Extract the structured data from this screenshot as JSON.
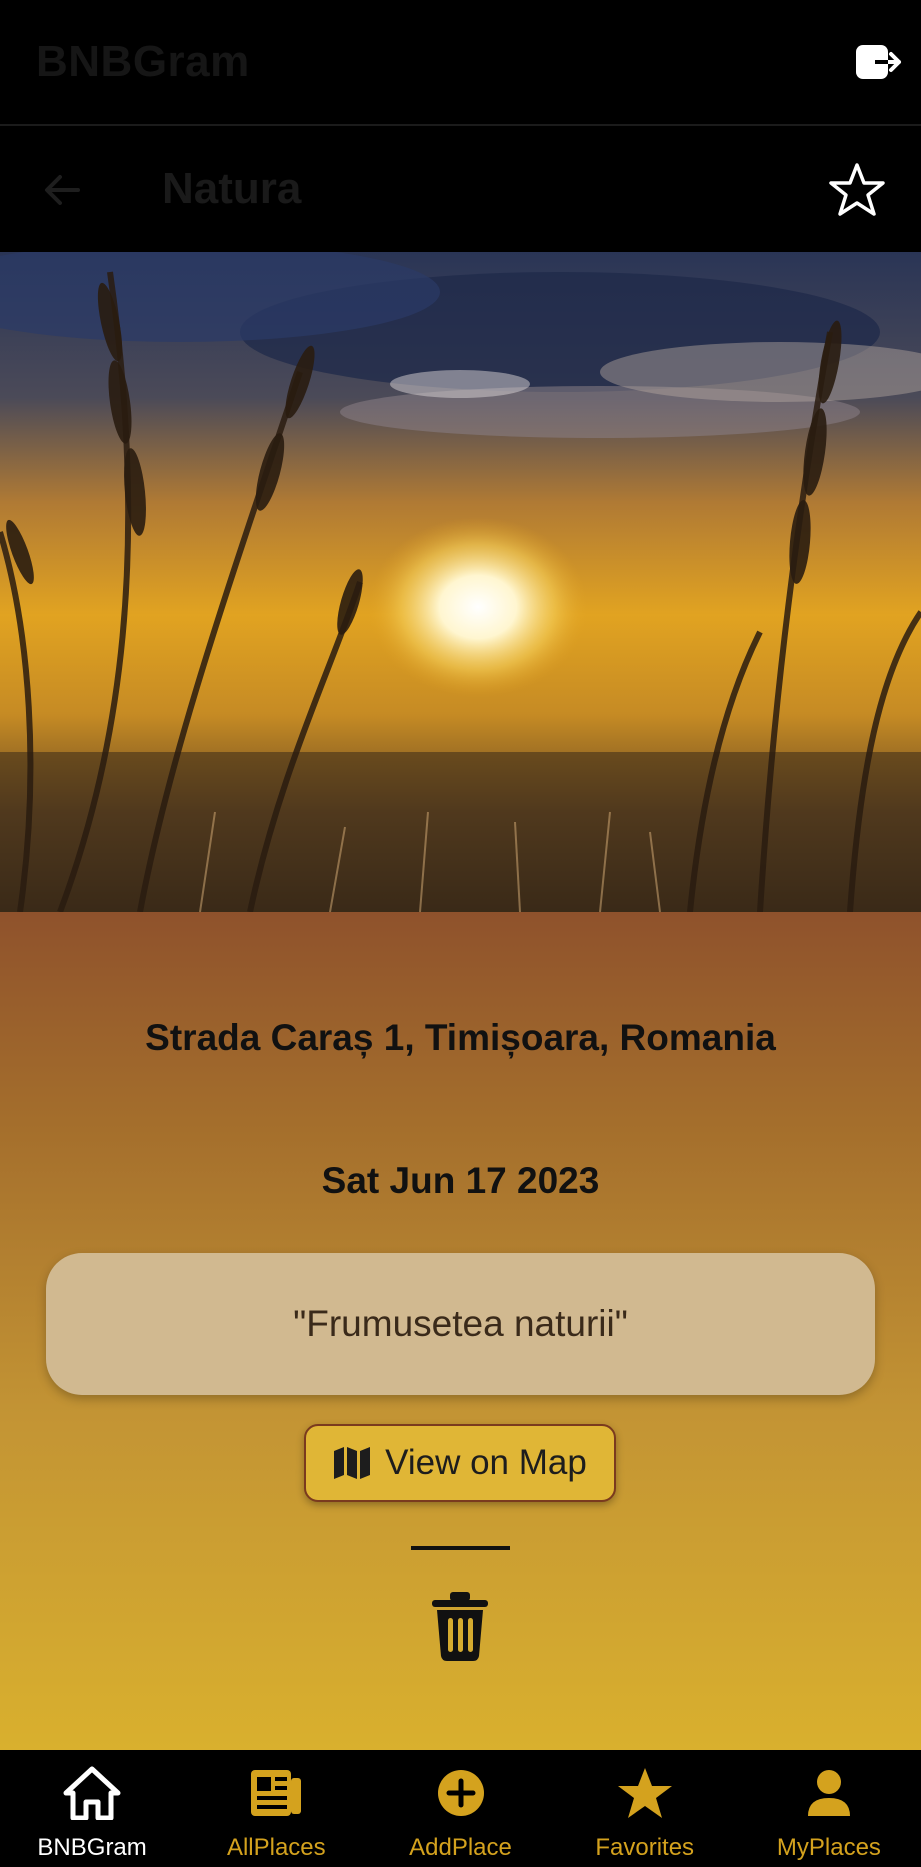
{
  "header": {
    "app_title": "BNBGram",
    "logout_icon": "logout-icon"
  },
  "subheader": {
    "title": "Natura",
    "back_icon": "arrow-left-icon",
    "favorite_icon": "star-outline-icon"
  },
  "place": {
    "photo": "sunset over wheat field",
    "address": "Strada Caraș 1, Timișoara, Romania",
    "date": "Sat Jun 17 2023",
    "description": "\"Frumusetea naturii\"",
    "map_button_label": "View on Map",
    "map_icon": "map-icon",
    "delete_icon": "trash-icon"
  },
  "bottom_nav": {
    "items": [
      {
        "label": "BNBGram",
        "icon": "home-icon",
        "active": true
      },
      {
        "label": "AllPlaces",
        "icon": "newspaper-icon",
        "active": false
      },
      {
        "label": "AddPlace",
        "icon": "add-circle-icon",
        "active": false
      },
      {
        "label": "Favorites",
        "icon": "star-icon",
        "active": false
      },
      {
        "label": "MyPlaces",
        "icon": "person-icon",
        "active": false
      }
    ]
  },
  "colors": {
    "accent": "#d4a21e",
    "active_nav": "#ffffff",
    "content_top": "#8f522c",
    "content_bottom": "#d9b02e",
    "card": "#d1b990"
  }
}
